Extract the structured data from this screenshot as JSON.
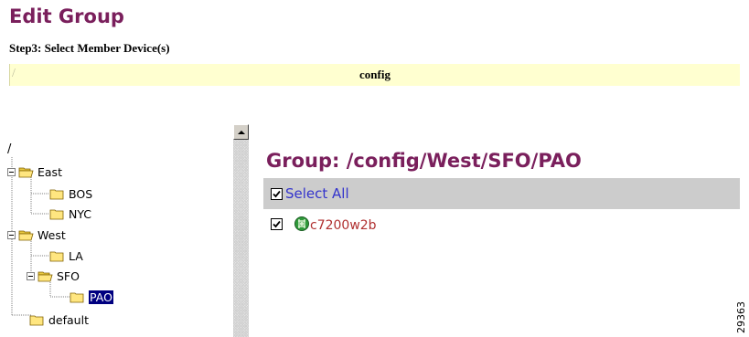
{
  "header": {
    "title": "Edit Group",
    "step": "Step3: Select Member Device(s)"
  },
  "config_bar": {
    "slash": "/",
    "label": "config"
  },
  "tree": {
    "root": "/",
    "items": [
      {
        "label": "East",
        "expanded": true
      },
      {
        "label": "BOS"
      },
      {
        "label": "NYC"
      },
      {
        "label": "West",
        "expanded": true
      },
      {
        "label": "LA"
      },
      {
        "label": "SFO",
        "expanded": true
      },
      {
        "label": "PAO",
        "selected": true
      },
      {
        "label": "default"
      }
    ]
  },
  "main": {
    "group_heading": "Group: /config/West/SFO/PAO",
    "select_all_label": "Select All",
    "select_all_checked": true,
    "devices": [
      {
        "name": "c7200w2b",
        "checked": true,
        "icon": "router-icon"
      }
    ]
  },
  "figure_id": "29363",
  "colors": {
    "title": "#7a1f5c",
    "config_bar": "#ffffd0",
    "select_bar": "#cccccc",
    "link_blue": "#3333cc",
    "device_red": "#b03030",
    "selection": "#000080"
  }
}
